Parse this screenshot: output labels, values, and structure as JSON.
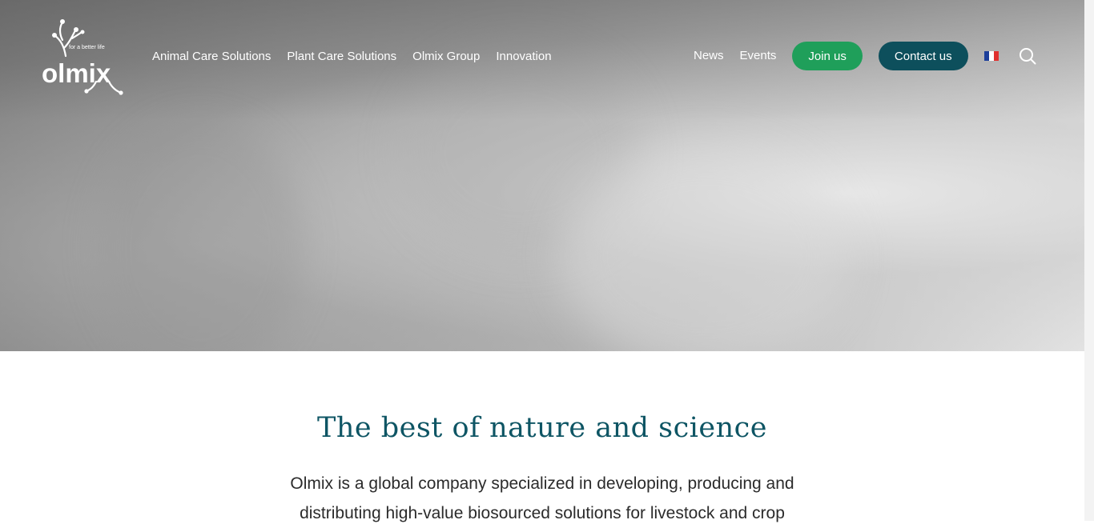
{
  "brand": {
    "logo_text": "olmix",
    "tagline": "for a better life"
  },
  "nav": {
    "primary": [
      {
        "label": "Animal Care Solutions"
      },
      {
        "label": "Plant Care Solutions"
      },
      {
        "label": "Olmix Group"
      },
      {
        "label": "Innovation"
      }
    ],
    "secondary": [
      {
        "label": "News"
      },
      {
        "label": "Events"
      }
    ],
    "join_label": "Join us",
    "contact_label": "Contact us",
    "language_flag": "flag-fr-icon",
    "search_icon": "search-icon"
  },
  "colors": {
    "join_button": "#1f9f5a",
    "contact_button": "#0d4f5c",
    "headline": "#0e5564"
  },
  "content": {
    "headline": "The best of nature and science",
    "intro": "Olmix is a global company specialized in developing, producing and distributing high-value biosourced solutions for livestock and crop"
  }
}
